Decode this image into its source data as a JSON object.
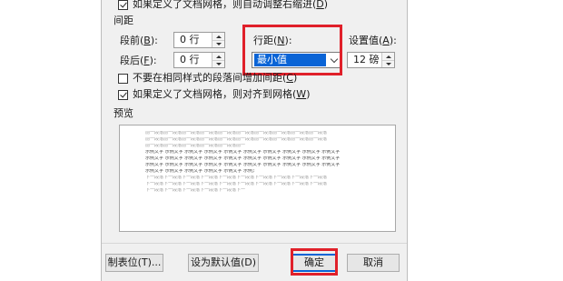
{
  "auto_indent_checkbox": {
    "label": "如果定义了文档网格，则自动调整右缩进(",
    "key": "D",
    "tail": ")",
    "checked": true
  },
  "spacing_section": {
    "title": "间距"
  },
  "before": {
    "label": "段前(",
    "key": "B",
    "tail": "):",
    "value": "0 行"
  },
  "after": {
    "label": "段后(",
    "key": "F",
    "tail": "):",
    "value": "0 行"
  },
  "line_spacing": {
    "label": "行距(",
    "key": "N",
    "tail": "):",
    "value": "最小值"
  },
  "setting_value": {
    "label": "设置值(",
    "key": "A",
    "tail": "):",
    "value": "12 磅"
  },
  "no_space_checkbox": {
    "label": "不要在相同样式的段落间增加间距(",
    "key": "C",
    "tail": ")",
    "checked": false
  },
  "snap_grid_checkbox": {
    "label": "如果定义了文档网格，则对齐到网格(",
    "key": "W",
    "tail": ")",
    "checked": true
  },
  "preview_section": {
    "title": "预览",
    "prev_text": "前一段落前一段落前一段落前一段落前一段落前一段落前一段落前一段落前一段落前一段落",
    "sample_text": "示例文字 示例文字 示例文字 示例文字 示例文字 示例文字 示例文字 示例文字 示例文字 示例文字",
    "next_text": "下一段落下一段落下一段落下一段落下一段落下一段落下一段落下一段落下一段落下一段落"
  },
  "buttons": {
    "tabs": "制表位(T)...",
    "set_default": "设为默认值(D)",
    "ok": "确定",
    "cancel": "取消"
  },
  "colors": {
    "highlight": "#e0202a",
    "selection": "#0a64d6"
  }
}
